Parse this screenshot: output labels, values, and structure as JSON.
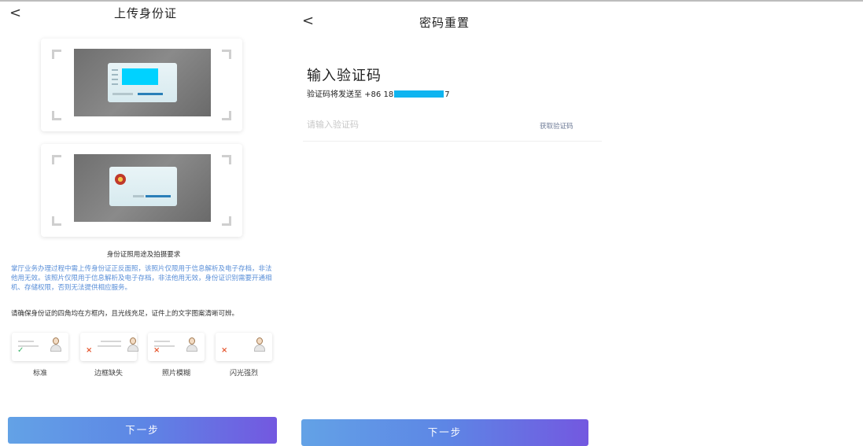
{
  "left": {
    "back_icon": "<",
    "title": "上传身份证",
    "requirements": {
      "title": "身份证照用途及拍摄要求",
      "blue_text": "掌厅业务办理过程中需上传身份证正反面照，该照片仅限用于信息解析及电子存档，非法他用无效。该照片仅限用于信息解析及电子存档，非法他用无效，身份证识别需要开通相机、存储权限，否则无法提供相应服务。",
      "dark_text": "请确保身份证的四角均在方框内，且光线充足，证件上的文字图案清晰可辨。"
    },
    "examples": [
      {
        "label": "标准",
        "mark": "✓",
        "status": "ok"
      },
      {
        "label": "边框缺失",
        "mark": "×",
        "status": "bad"
      },
      {
        "label": "照片模糊",
        "mark": "×",
        "status": "bad"
      },
      {
        "label": "闪光强烈",
        "mark": "×",
        "status": "bad"
      }
    ],
    "next_label": "下一步"
  },
  "right": {
    "back_icon": "<",
    "title": "密码重置",
    "heading": "输入验证码",
    "sent_prefix": "验证码将发送至 +86 18",
    "sent_suffix": "7",
    "code_placeholder": "请输入验证码",
    "get_code_label": "获取验证码",
    "next_label": "下一步"
  },
  "colors": {
    "button_gradient": [
      "#63a2e6",
      "#7358e0"
    ],
    "info_blue": "#5a8fd8",
    "mask_cyan": "#0fb4f0"
  }
}
